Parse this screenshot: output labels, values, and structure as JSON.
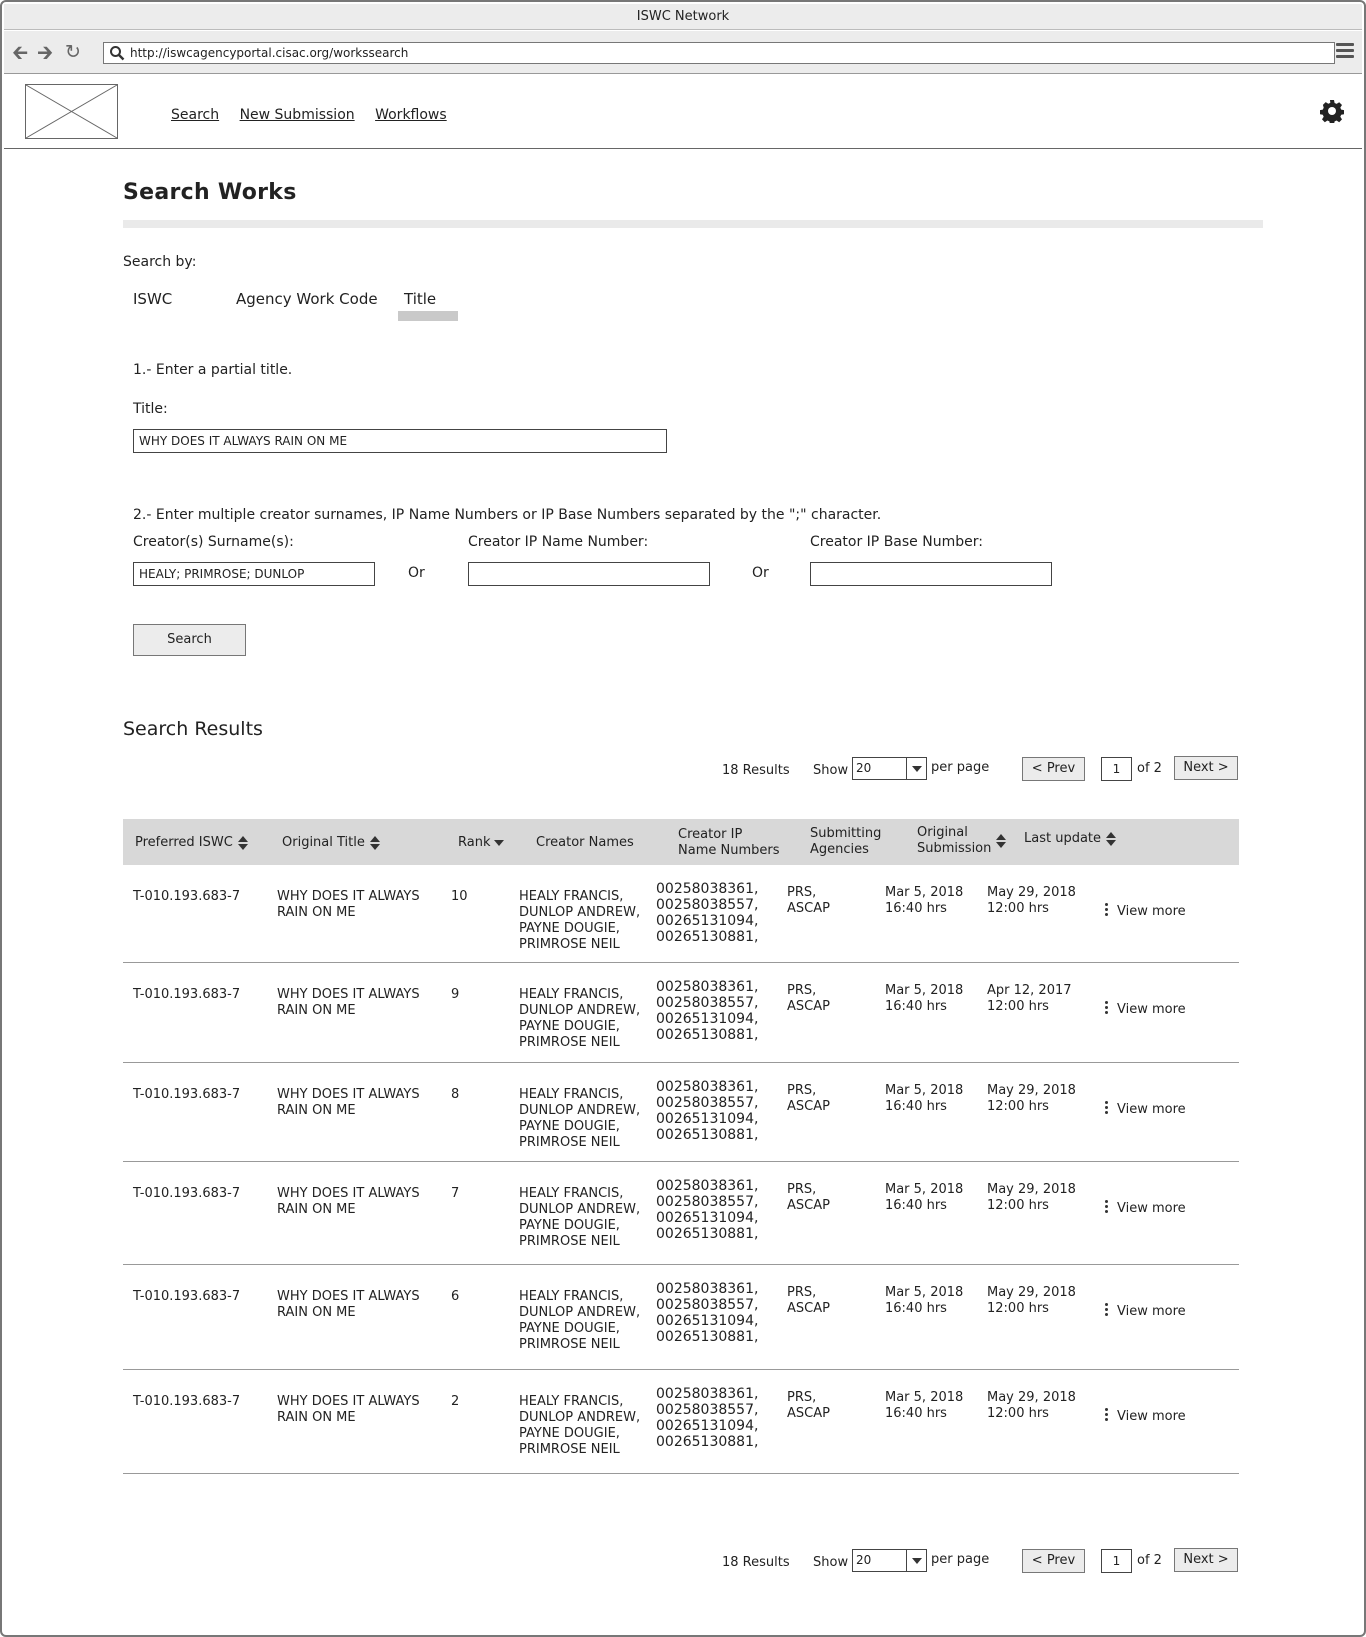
{
  "window": {
    "title": "ISWC Network",
    "url": "http://iswcagencyportal.cisac.org/workssearch"
  },
  "nav": {
    "search": "Search",
    "new_submission": "New Submission",
    "workflows": "Workflows"
  },
  "page": {
    "title": "Search Works",
    "search_by_label": "Search by:",
    "tabs": [
      "ISWC",
      "Agency Work Code",
      "Title"
    ],
    "active_tab": "Title",
    "step1": "1.- Enter a partial title.",
    "title_label": "Title:",
    "title_value": "WHY DOES IT ALWAYS RAIN ON ME",
    "step2": "2.- Enter multiple creator surnames, IP Name Numbers or IP Base Numbers separated by the \";\" character.",
    "creator_surname_label": "Creator(s) Surname(s):",
    "creator_surname_value": "HEALY; PRIMROSE; DUNLOP",
    "creator_ip_name_label": "Creator IP Name Number:",
    "creator_ip_name_value": "",
    "creator_ip_base_label": "Creator IP Base Number:",
    "creator_ip_base_value": "",
    "or_label": "Or",
    "search_button": "Search",
    "results_title": "Search Results"
  },
  "pager": {
    "count": "18 Results",
    "show": "Show",
    "page_size": "20",
    "per_page": "per page",
    "prev": "< Prev",
    "page": "1",
    "of": "of 2",
    "next": "Next >"
  },
  "table": {
    "headers": {
      "iswc": "Preferred ISWC",
      "title": "Original Title",
      "rank": "Rank",
      "creators": "Creator Names",
      "ip": "Creator IP\nName Numbers",
      "agencies": "Submitting\nAgencies",
      "orig": "Original\nSubmission",
      "last": "Last update"
    },
    "view_more": "View more",
    "rows": [
      {
        "iswc": "T-010.193.683-7",
        "title": "WHY DOES IT ALWAYS\nRAIN ON ME",
        "rank": "10",
        "creators": "HEALY FRANCIS,\nDUNLOP ANDREW,\nPAYNE DOUGIE,\nPRIMROSE NEIL",
        "ip": "00258038361,\n00258038557,\n00265131094,\n00265130881,",
        "agencies": "PRS,\nASCAP",
        "orig": "Mar 5, 2018\n16:40 hrs",
        "last": "May 29, 2018\n12:00 hrs"
      },
      {
        "iswc": "T-010.193.683-7",
        "title": "WHY DOES IT ALWAYS\nRAIN ON ME",
        "rank": "9",
        "creators": "HEALY FRANCIS,\nDUNLOP ANDREW,\nPAYNE DOUGIE,\nPRIMROSE NEIL",
        "ip": "00258038361,\n00258038557,\n00265131094,\n00265130881,",
        "agencies": "PRS,\nASCAP",
        "orig": "Mar 5, 2018\n16:40 hrs",
        "last": "Apr 12, 2017\n12:00 hrs"
      },
      {
        "iswc": "T-010.193.683-7",
        "title": "WHY DOES IT ALWAYS\nRAIN ON ME",
        "rank": "8",
        "creators": "HEALY FRANCIS,\nDUNLOP ANDREW,\nPAYNE DOUGIE,\nPRIMROSE NEIL",
        "ip": "00258038361,\n00258038557,\n00265131094,\n00265130881,",
        "agencies": "PRS,\nASCAP",
        "orig": "Mar 5, 2018\n16:40 hrs",
        "last": "May 29, 2018\n12:00 hrs"
      },
      {
        "iswc": "T-010.193.683-7",
        "title": "WHY DOES IT ALWAYS\nRAIN ON ME",
        "rank": "7",
        "creators": "HEALY FRANCIS,\nDUNLOP ANDREW,\nPAYNE DOUGIE,\nPRIMROSE NEIL",
        "ip": "00258038361,\n00258038557,\n00265131094,\n00265130881,",
        "agencies": "PRS,\nASCAP",
        "orig": "Mar 5, 2018\n16:40 hrs",
        "last": "May 29, 2018\n12:00 hrs"
      },
      {
        "iswc": "T-010.193.683-7",
        "title": "WHY DOES IT ALWAYS\nRAIN ON ME",
        "rank": "6",
        "creators": "HEALY FRANCIS,\nDUNLOP ANDREW,\nPAYNE DOUGIE,\nPRIMROSE NEIL",
        "ip": "00258038361,\n00258038557,\n00265131094,\n00265130881,",
        "agencies": "PRS,\nASCAP",
        "orig": "Mar 5, 2018\n16:40 hrs",
        "last": "May 29, 2018\n12:00 hrs"
      },
      {
        "iswc": "T-010.193.683-7",
        "title": "WHY DOES IT ALWAYS\nRAIN ON ME",
        "rank": "2",
        "creators": "HEALY FRANCIS,\nDUNLOP ANDREW,\nPAYNE DOUGIE,\nPRIMROSE NEIL",
        "ip": "00258038361,\n00258038557,\n00265131094,\n00265130881,",
        "agencies": "PRS,\nASCAP",
        "orig": "Mar 5, 2018\n16:40 hrs",
        "last": "May 29, 2018\n12:00 hrs"
      }
    ]
  }
}
